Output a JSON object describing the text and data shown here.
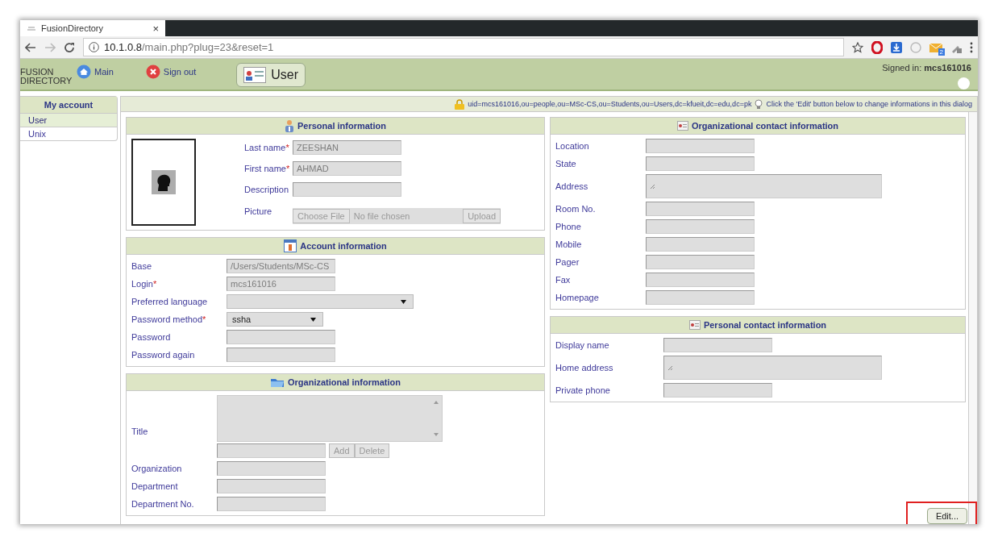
{
  "browser": {
    "tab_title": "FusionDirectory",
    "tab_close": "×",
    "url_host": "10.1.0.8",
    "url_path": "/main.php?plug=23&reset=1",
    "extension_badge": "2"
  },
  "header": {
    "logo_lines": [
      "FUSION",
      "DIRECTORY"
    ],
    "nav": [
      {
        "label": "Main",
        "kind": "home"
      },
      {
        "label": "Sign out",
        "kind": "signout"
      }
    ],
    "plugin_tab": {
      "label": "User"
    },
    "signed_in_label": "Signed in:",
    "signed_in_user": "mcs161016"
  },
  "sidebar": {
    "title": "My account",
    "items": [
      {
        "label": "User",
        "selected": true
      },
      {
        "label": "Unix",
        "selected": false
      }
    ]
  },
  "dn_bar": {
    "dn": "uid=mcs161016,ou=people,ou=MSc-CS,ou=Students,ou=Users,dc=kfueit,dc=edu,dc=pk",
    "hint": "Click the 'Edit' button below to change informations in this dialog"
  },
  "columns": [
    [
      {
        "title": "Personal information",
        "fields": [
          {
            "kind": "text",
            "label": "Last name",
            "mark": "*",
            "value": "ZEESHAN"
          },
          {
            "kind": "text",
            "label": "First name",
            "mark": "*",
            "value": "AHMAD"
          },
          {
            "kind": "text",
            "label": "Description"
          },
          {
            "kind": "file",
            "label": "Picture",
            "button": "Choose File",
            "status": "No file chosen",
            "upload": "Upload"
          }
        ]
      },
      {
        "title": "Account information",
        "fields": [
          {
            "kind": "text",
            "label": "Base",
            "value": "/Users/Students/MSc-CS"
          },
          {
            "kind": "text",
            "label": "Login",
            "mark": "*",
            "value": "mcs161016"
          },
          {
            "kind": "select",
            "label": "Preferred language"
          },
          {
            "kind": "select",
            "label": "Password method",
            "mark": "*",
            "value": "ssha"
          },
          {
            "kind": "text",
            "label": "Password"
          },
          {
            "kind": "text",
            "label": "Password again"
          }
        ]
      },
      {
        "title": "Organizational information",
        "fields": [
          {
            "kind": "list",
            "label": "Title",
            "add": "Add",
            "delete": "Delete"
          },
          {
            "kind": "text",
            "label": "Organization"
          },
          {
            "kind": "text",
            "label": "Department"
          },
          {
            "kind": "text",
            "label": "Department No."
          }
        ]
      }
    ],
    [
      {
        "title": "Organizational contact information",
        "fields": [
          {
            "kind": "text",
            "label": "Location"
          },
          {
            "kind": "text",
            "label": "State"
          },
          {
            "kind": "textarea",
            "label": "Address"
          },
          {
            "kind": "text",
            "label": "Room No."
          },
          {
            "kind": "text",
            "label": "Phone"
          },
          {
            "kind": "text",
            "label": "Mobile"
          },
          {
            "kind": "text",
            "label": "Pager"
          },
          {
            "kind": "text",
            "label": "Fax"
          },
          {
            "kind": "text",
            "label": "Homepage"
          }
        ]
      },
      {
        "title": "Personal contact information",
        "fields": [
          {
            "kind": "text",
            "label": "Display name"
          },
          {
            "kind": "textarea",
            "label": "Home address"
          },
          {
            "kind": "text",
            "label": "Private phone"
          }
        ]
      }
    ]
  ],
  "edit_button": {
    "label": "Edit...",
    "highlighted": true
  }
}
